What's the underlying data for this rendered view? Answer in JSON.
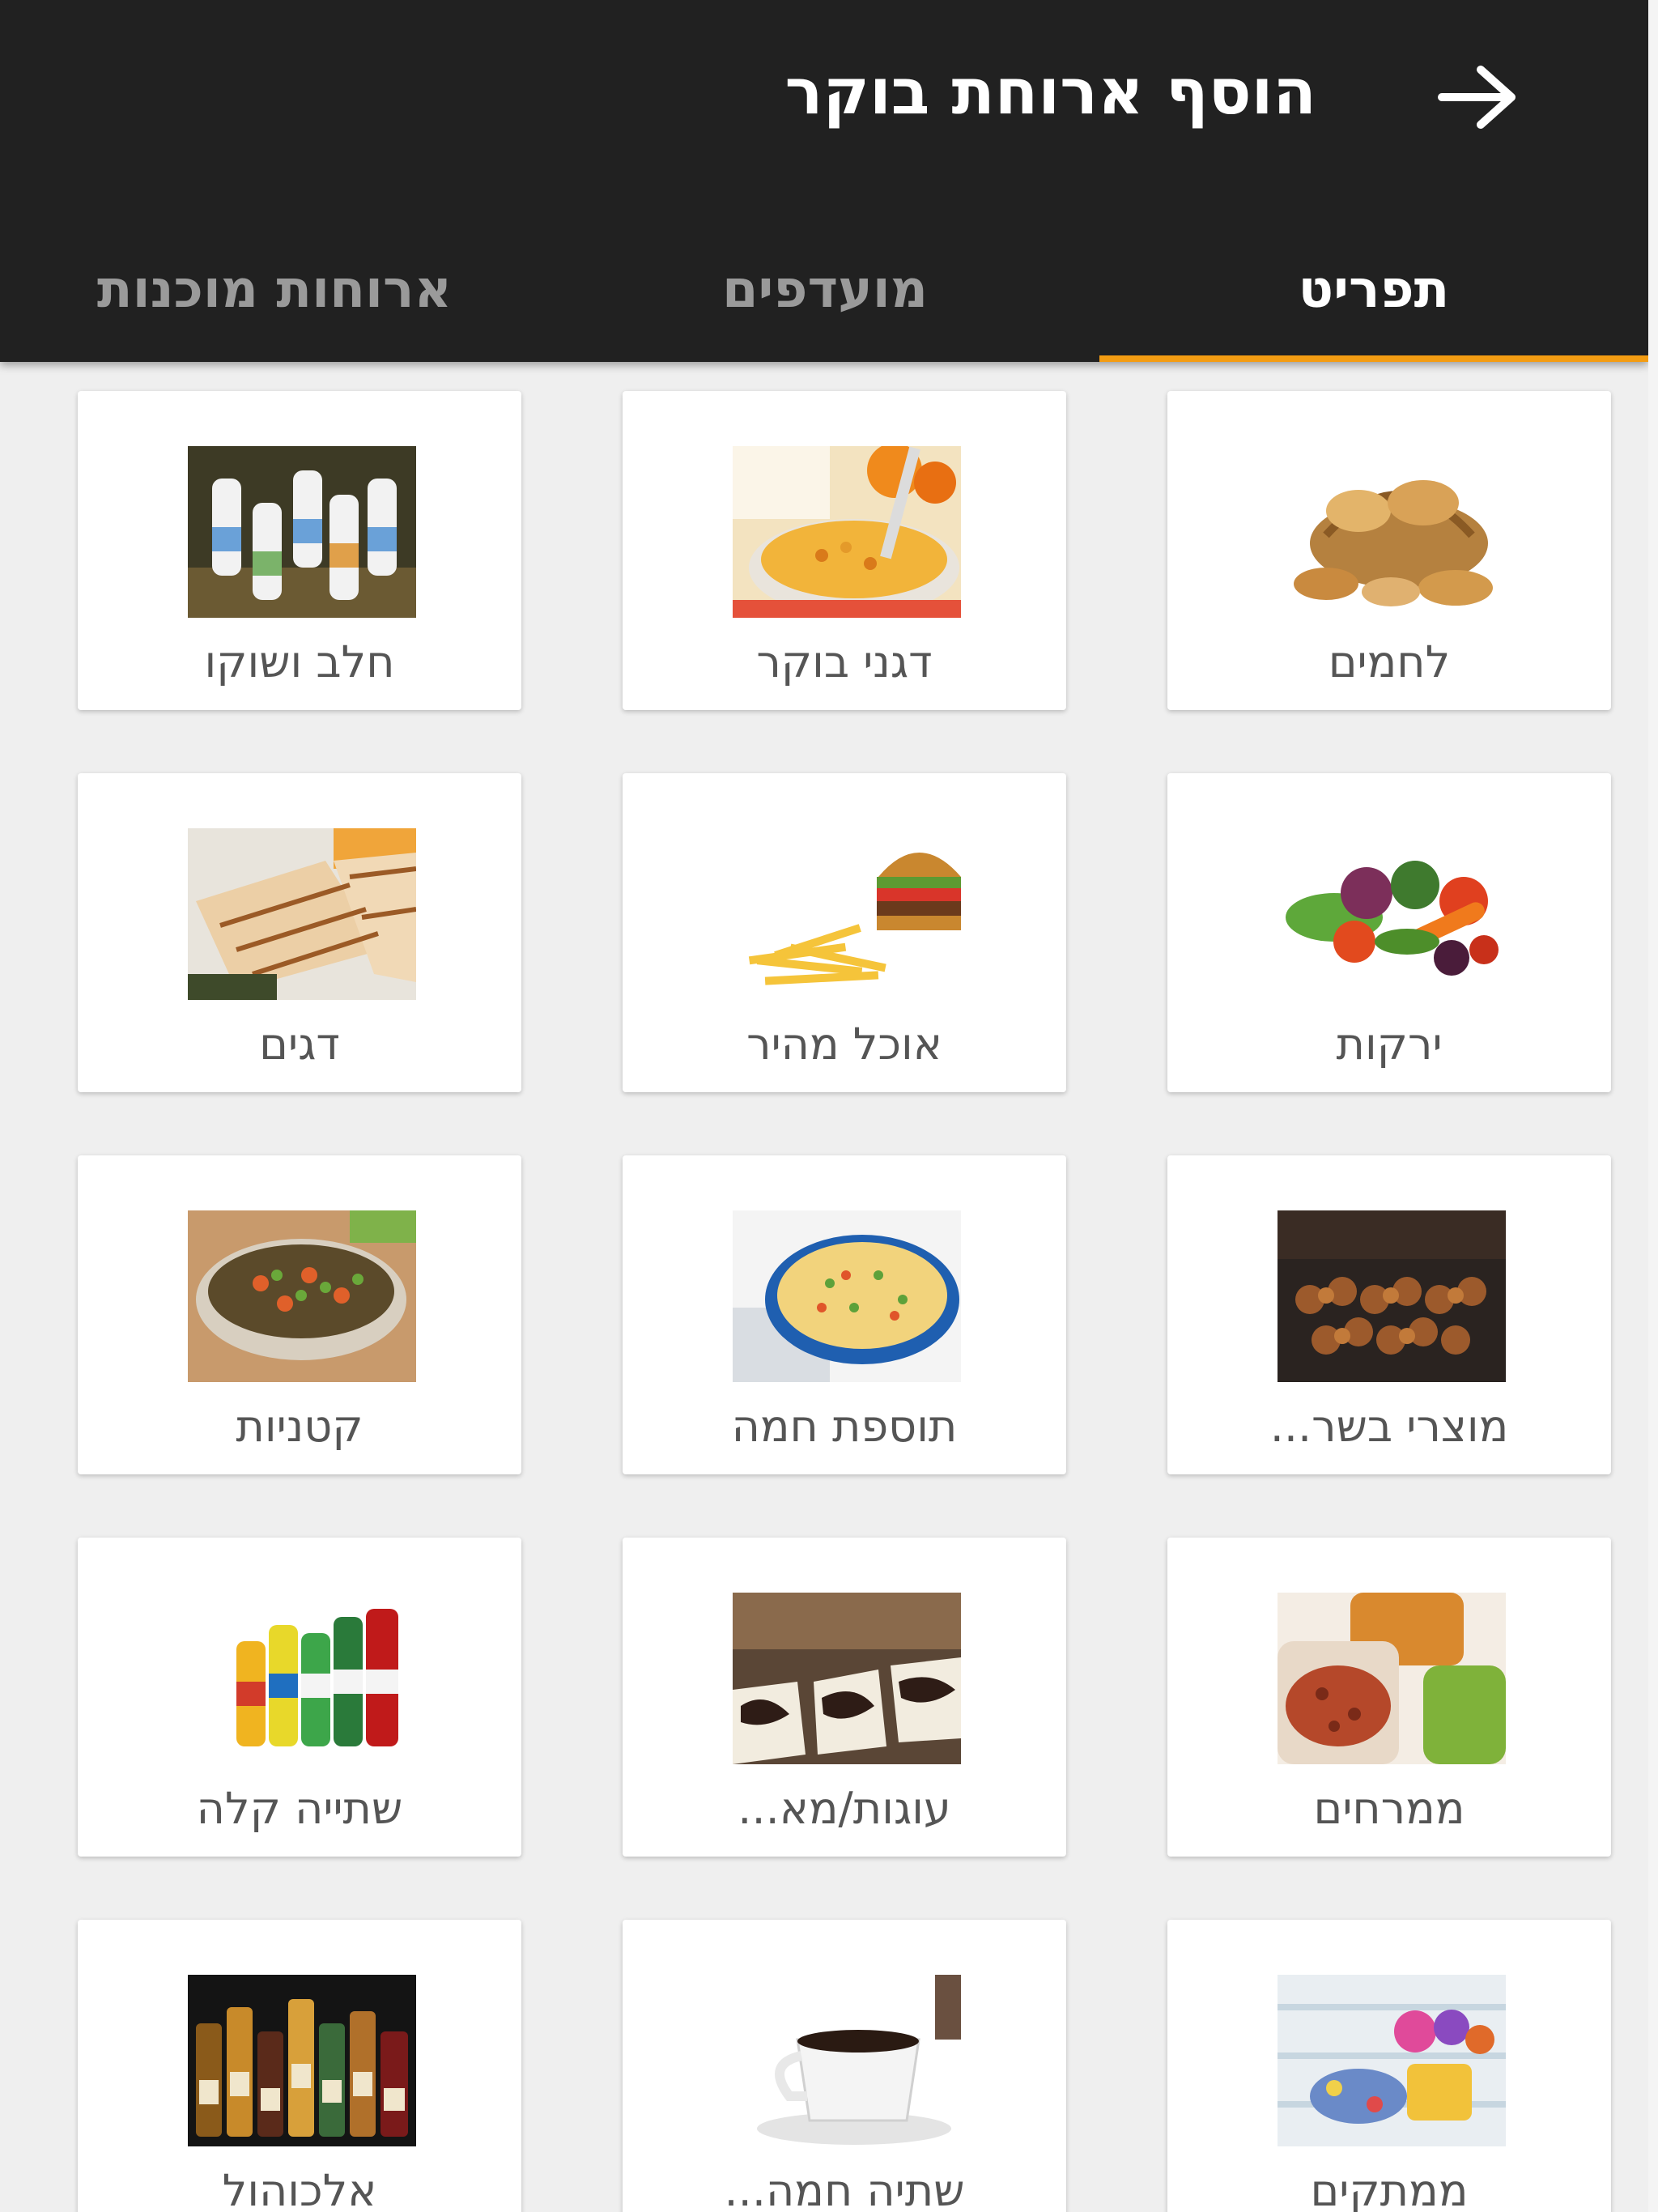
{
  "appbar": {
    "title": "הוסף ארוחת בוקר",
    "back_icon": "arrow-right-icon"
  },
  "tabs": [
    {
      "label": "תפריט",
      "active": true
    },
    {
      "label": "מועדפים",
      "active": false
    },
    {
      "label": "ארוחות מוכנות",
      "active": false
    }
  ],
  "colors": {
    "appbar_bg": "#212121",
    "tab_indicator": "#f39c12",
    "page_bg": "#efefef",
    "card_bg": "#ffffff"
  },
  "categories": [
    {
      "label": "לחמים",
      "image": "bread-basket"
    },
    {
      "label": "דגני בוקר",
      "image": "breakfast-cereal"
    },
    {
      "label": "חלב ושוקו",
      "image": "milk-bottles"
    },
    {
      "label": "ירקות",
      "image": "vegetables"
    },
    {
      "label": "אוכל מהיר",
      "image": "burger-and-fries"
    },
    {
      "label": "דגים",
      "image": "grilled-fish"
    },
    {
      "label": "מוצרי בשר...",
      "image": "meat-skewers"
    },
    {
      "label": "תוספת חמה",
      "image": "rice-casserole"
    },
    {
      "label": "קטניות",
      "image": "lentil-bowl"
    },
    {
      "label": "ממרחים",
      "image": "spread-jars"
    },
    {
      "label": "עוגות/מא...",
      "image": "marble-cake"
    },
    {
      "label": "שתייה קלה",
      "image": "soft-drink-bottles"
    },
    {
      "label": "ממתקים",
      "image": "candies"
    },
    {
      "label": "שתיה חמה...",
      "image": "coffee-cup"
    },
    {
      "label": "אלכוהול",
      "image": "liquor-bottles"
    }
  ]
}
